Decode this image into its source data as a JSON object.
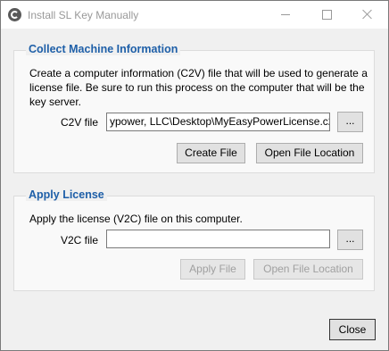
{
  "window": {
    "title": "Install SL Key Manually",
    "app_icon": "app-logo-icon",
    "controls": {
      "minimize": "minimize-icon",
      "maximize": "maximize-icon",
      "close": "close-icon"
    }
  },
  "collect_section": {
    "title": "Collect Machine Information",
    "description": "Create a computer information (C2V) file that will be used to generate a license file. Be sure to run this process on the computer that will be the key server.",
    "file_label": "C2V file",
    "file_value": "ypower, LLC\\Desktop\\MyEasyPowerLicense.c2v",
    "browse_label": "...",
    "create_button": "Create File",
    "open_location_button": "Open File Location"
  },
  "apply_section": {
    "title": "Apply License",
    "description": "Apply the license (V2C) file on this computer.",
    "file_label": "V2C file",
    "file_value": "",
    "browse_label": "...",
    "apply_button": "Apply File",
    "open_location_button": "Open File Location"
  },
  "footer": {
    "close_button": "Close"
  },
  "colors": {
    "section_title": "#1e5fa8",
    "disabled_text": "#a0a0a0"
  }
}
